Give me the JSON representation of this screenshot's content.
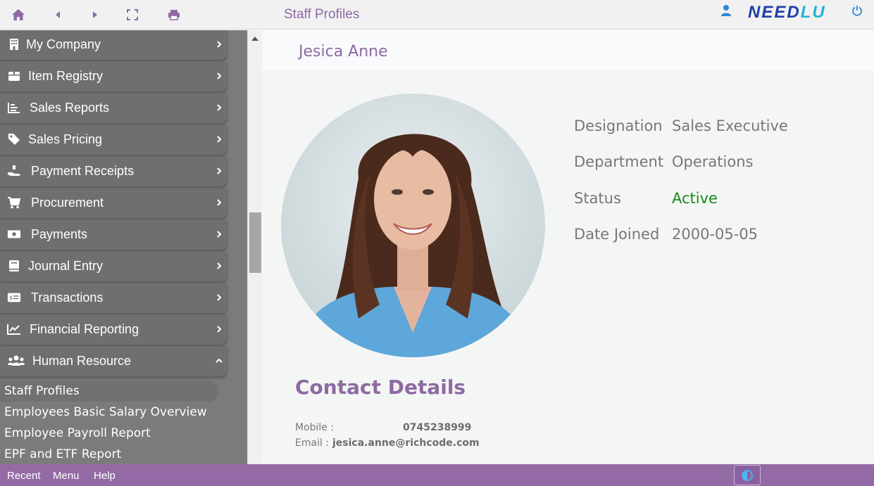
{
  "topbar": {
    "title": "Staff Profiles",
    "logo_main": "NEED",
    "logo_accent": "LU",
    "icons": [
      "home-icon",
      "back-icon",
      "forward-icon",
      "fullscreen-icon",
      "print-icon",
      "user-icon",
      "power-icon"
    ]
  },
  "sidebar": {
    "items": [
      {
        "label": "My Company",
        "icon": "building-icon"
      },
      {
        "label": "Item Registry",
        "icon": "box-icon"
      },
      {
        "label": "Sales Reports",
        "icon": "bar-chart-icon"
      },
      {
        "label": "Sales Pricing",
        "icon": "tag-icon"
      },
      {
        "label": "Payment Receipts",
        "icon": "hand-money-icon"
      },
      {
        "label": "Procurement",
        "icon": "cart-icon"
      },
      {
        "label": "Payments",
        "icon": "money-icon"
      },
      {
        "label": "Journal Entry",
        "icon": "book-icon"
      },
      {
        "label": "Transactions",
        "icon": "dollar-card-icon"
      },
      {
        "label": "Financial Reporting",
        "icon": "line-chart-icon"
      },
      {
        "label": "Human Resource",
        "icon": "users-icon"
      }
    ],
    "subitems": [
      {
        "label": "Staff Profiles"
      },
      {
        "label": "Employees Basic Salary Overview"
      },
      {
        "label": "Employee Payroll Report"
      },
      {
        "label": "EPF and ETF Report"
      }
    ]
  },
  "profile": {
    "name": "Jesica Anne",
    "details": [
      {
        "label": "Designation",
        "value": "Sales Executive"
      },
      {
        "label": "Department",
        "value": "Operations"
      },
      {
        "label": "Status",
        "value": "Active"
      },
      {
        "label": "Date Joined",
        "value": "2000-05-05"
      }
    ]
  },
  "contact": {
    "title": "Contact Details",
    "mobile_label": "Mobile :",
    "mobile_value": "0745238999",
    "email_label": "Email :",
    "email_value": "jesica.anne@richcode.com"
  },
  "bottombar": {
    "recent": "Recent",
    "menu": "Menu",
    "help": "Help"
  },
  "colors": {
    "accent": "#8e6aa3",
    "bottom_bar": "#936aa6",
    "status_active": "#1a8a1a",
    "sidebar": "#7b7b7b"
  }
}
